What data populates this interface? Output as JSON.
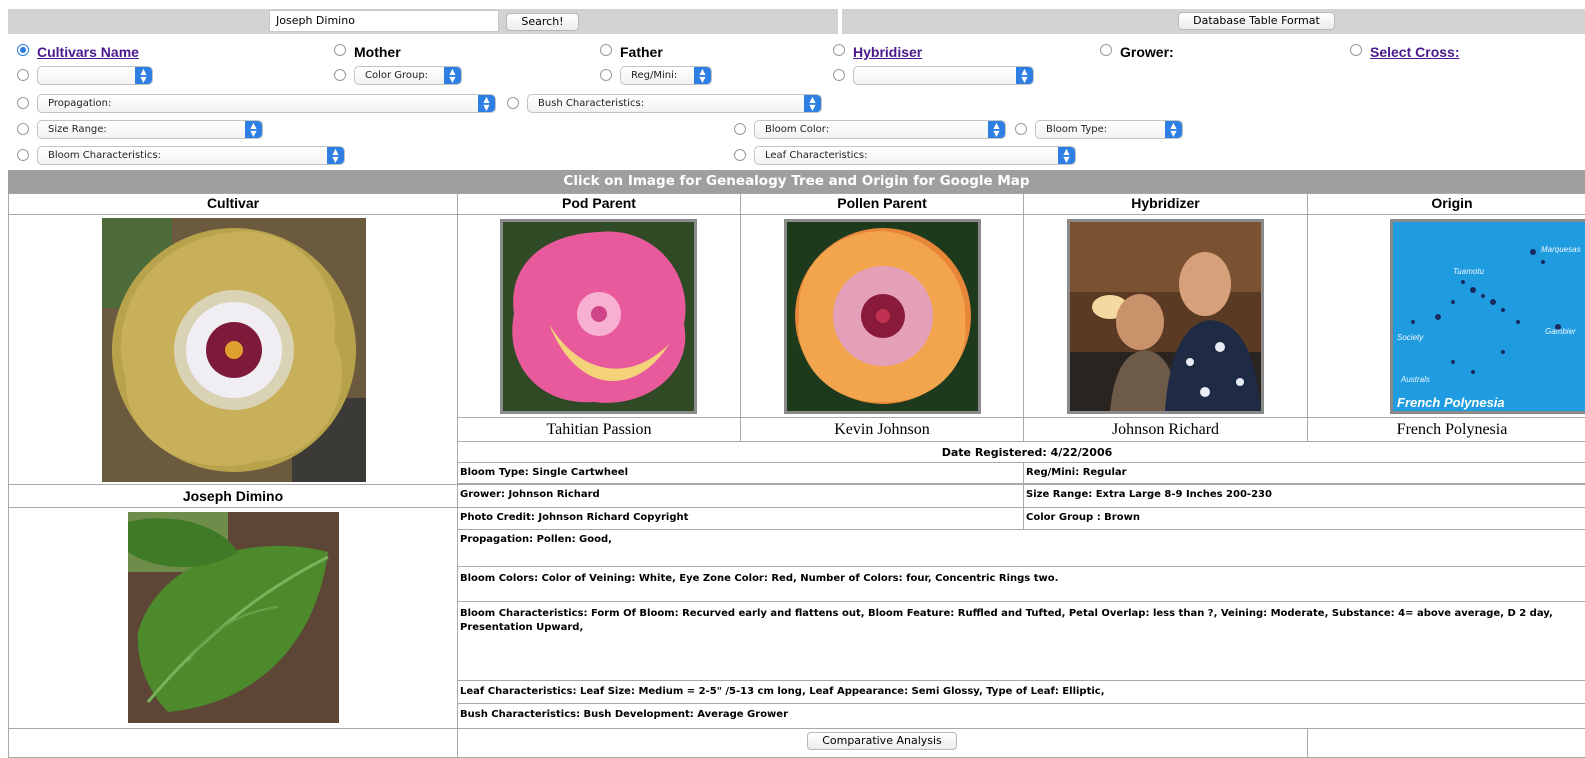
{
  "search": {
    "value": "Joseph Dimino",
    "button_label": "Search!"
  },
  "database_button_label": "Database Table Format",
  "filters": {
    "cultivars_name": "Cultivars Name",
    "mother": "Mother",
    "father": "Father",
    "hybridiser": "Hybridiser",
    "grower": "Grower:",
    "select_cross": "Select Cross:",
    "color_group": "Color Group:",
    "reg_mini": "Reg/Mini:",
    "propagation": "Propagation:",
    "bush_characteristics": "Bush Characteristics:",
    "size_range": "Size Range:",
    "bloom_color": "Bloom Color:",
    "bloom_type": "Bloom Type:",
    "bloom_characteristics": "Bloom Characteristics:",
    "leaf_characteristics": "Leaf Characteristics:"
  },
  "banner": "Click on Image for Genealogy Tree and Origin for Google Map",
  "columns": [
    "Cultivar",
    "Pod Parent",
    "Pollen Parent",
    "Hybridizer",
    "Origin"
  ],
  "captions": {
    "pod_parent": "Tahitian Passion",
    "pollen_parent": "Kevin Johnson",
    "hybridizer": "Johnson Richard",
    "origin": "French Polynesia"
  },
  "cultivar_name": "Joseph Dimino",
  "map": {
    "label": "French Polynesia",
    "islands": [
      "Tuamotu",
      "Marquesas",
      "Society",
      "Gambier",
      "Australs"
    ]
  },
  "details": {
    "date_registered": "Date Registered: 4/22/2006",
    "bloom_type": "Bloom Type: Single Cartwheel",
    "reg_mini": "Reg/Mini: Regular",
    "grower": "Grower: Johnson Richard",
    "size_range": "Size Range: Extra Large 8-9 Inches 200-230",
    "photo_credit": "Photo Credit: Johnson Richard Copyright",
    "color_group": "Color Group : Brown",
    "propagation": "Propagation: Pollen: Good,",
    "bloom_colors": "Bloom Colors: Color of Veining: White, Eye Zone Color: Red, Number of Colors: four, Concentric Rings two.",
    "bloom_characteristics": "Bloom Characteristics: Form Of Bloom: Recurved early and flattens out, Bloom Feature: Ruffled and Tufted, Petal Overlap: less than ?, Veining: Moderate, Substance: 4= above average, D 2 day, Presentation Upward,",
    "leaf_characteristics": "Leaf Characteristics: Leaf Size: Medium = 2-5\" /5-13 cm long, Leaf Appearance: Semi Glossy, Type of Leaf: Elliptic,",
    "bush_characteristics": "Bush Characteristics: Bush Development: Average Grower"
  },
  "comparative_label": "Comparative Analysis",
  "colors": {
    "banner": "#9f9f9f",
    "link": "#4a1a8c",
    "select_accent": "#2d7fe3",
    "radio_checked": "#2a7de1"
  }
}
